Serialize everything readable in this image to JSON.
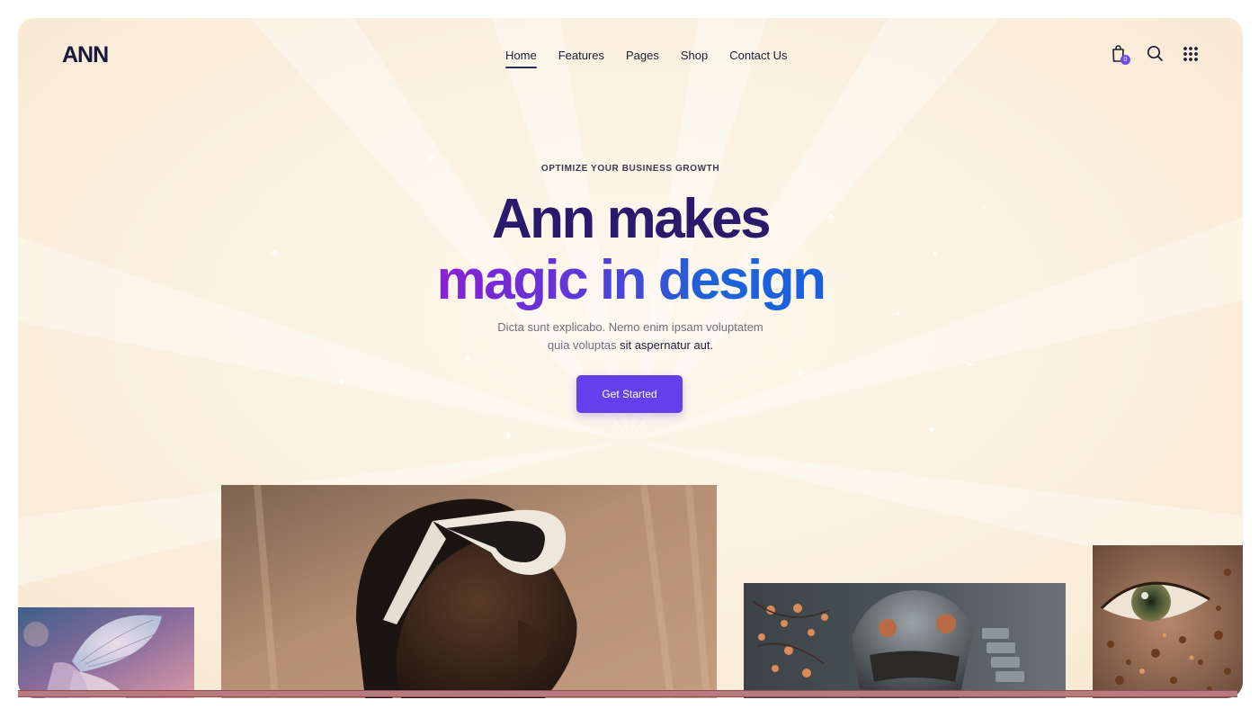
{
  "brand": {
    "logo_text": "ANN"
  },
  "nav": {
    "items": [
      {
        "label": "Home",
        "active": true
      },
      {
        "label": "Features",
        "active": false
      },
      {
        "label": "Pages",
        "active": false
      },
      {
        "label": "Shop",
        "active": false
      },
      {
        "label": "Contact Us",
        "active": false
      }
    ]
  },
  "header_icons": {
    "cart_count": "0",
    "icons": [
      "shopping-bag-icon",
      "search-icon",
      "grid-menu-icon"
    ]
  },
  "hero": {
    "eyebrow": "OPTIMIZE YOUR BUSINESS GROWTH",
    "title_line1": "Ann makes",
    "title_line2": "magic in design",
    "description_line1": "Dicta sunt explicabo. Nemo enim ipsam voluptatem",
    "description_line2_start": "quia voluptas ",
    "description_line2_emphasis": "sit aspernatur aut.",
    "cta_label": "Get Started"
  },
  "colors": {
    "accent": "#6240ec",
    "title_dark": "#2a1a6b",
    "gradient_start": "#8a1fd6",
    "gradient_end": "#1a5fe0",
    "navy": "#171a3d"
  },
  "gallery": {
    "images": [
      {
        "subject": "butterfly"
      },
      {
        "subject": "person-with-white-sunglasses"
      },
      {
        "subject": "samurai-helmet-with-blossoms"
      },
      {
        "subject": "freckled-eye-closeup"
      }
    ]
  }
}
